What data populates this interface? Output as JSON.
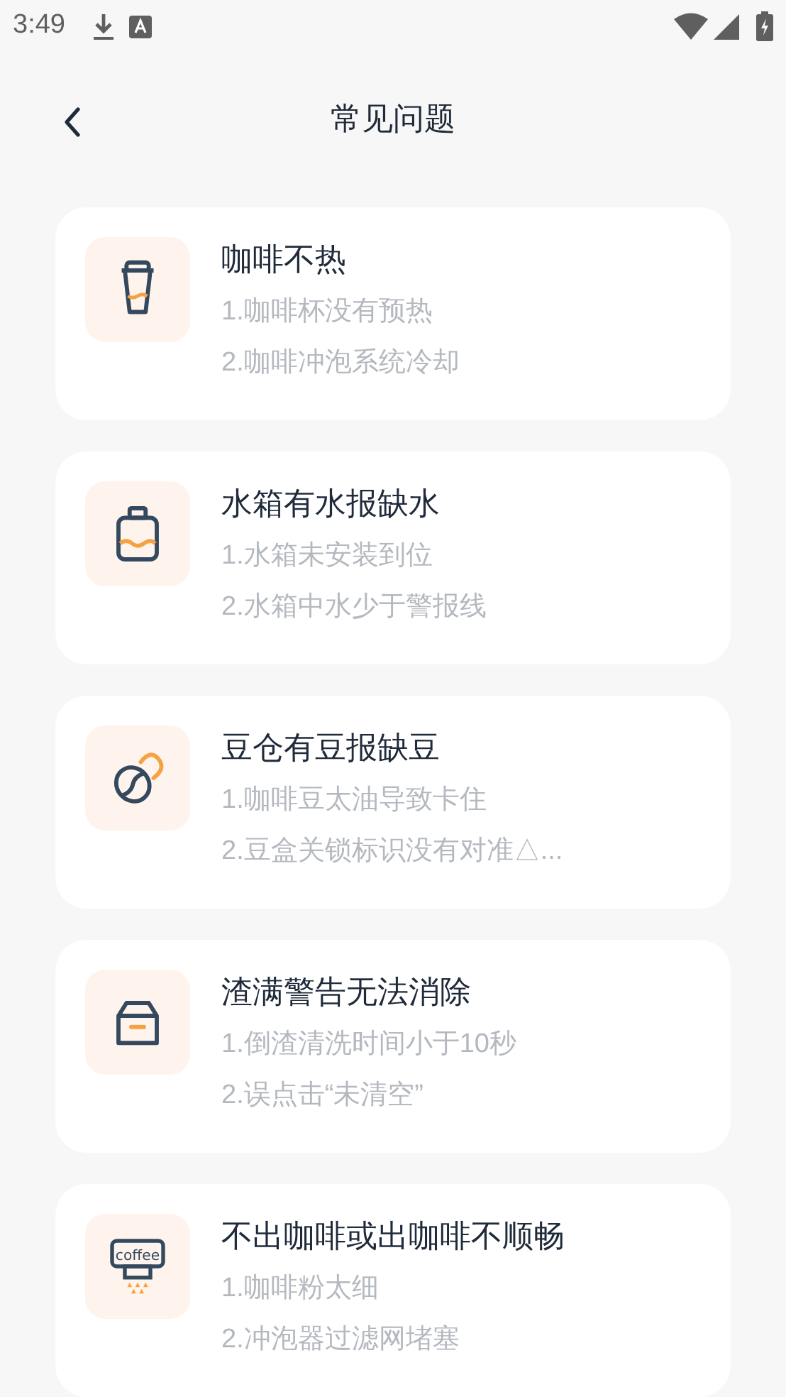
{
  "status_bar": {
    "time": "3:49"
  },
  "header": {
    "title": "常见问题"
  },
  "items": [
    {
      "kind": "cup",
      "title": "咖啡不热",
      "lines": [
        "1.咖啡杯没有预热",
        "2.咖啡冲泡系统冷却"
      ]
    },
    {
      "kind": "tank",
      "title": "水箱有水报缺水",
      "lines": [
        "1.水箱未安装到位",
        "2.水箱中水少于警报线"
      ]
    },
    {
      "kind": "bean",
      "title": "豆仓有豆报缺豆",
      "lines": [
        "1.咖啡豆太油导致卡住",
        "2.豆盒关锁标识没有对准△..."
      ]
    },
    {
      "kind": "box",
      "title": "渣满警告无法消除",
      "lines": [
        "1.倒渣清洗时间小于10秒",
        "2.误点击“未清空”"
      ]
    },
    {
      "kind": "machine",
      "icon_label": "coffee",
      "title": "不出咖啡或出咖啡不顺畅",
      "lines": [
        "1.咖啡粉太细",
        "2.冲泡器过滤网堵塞"
      ]
    }
  ]
}
